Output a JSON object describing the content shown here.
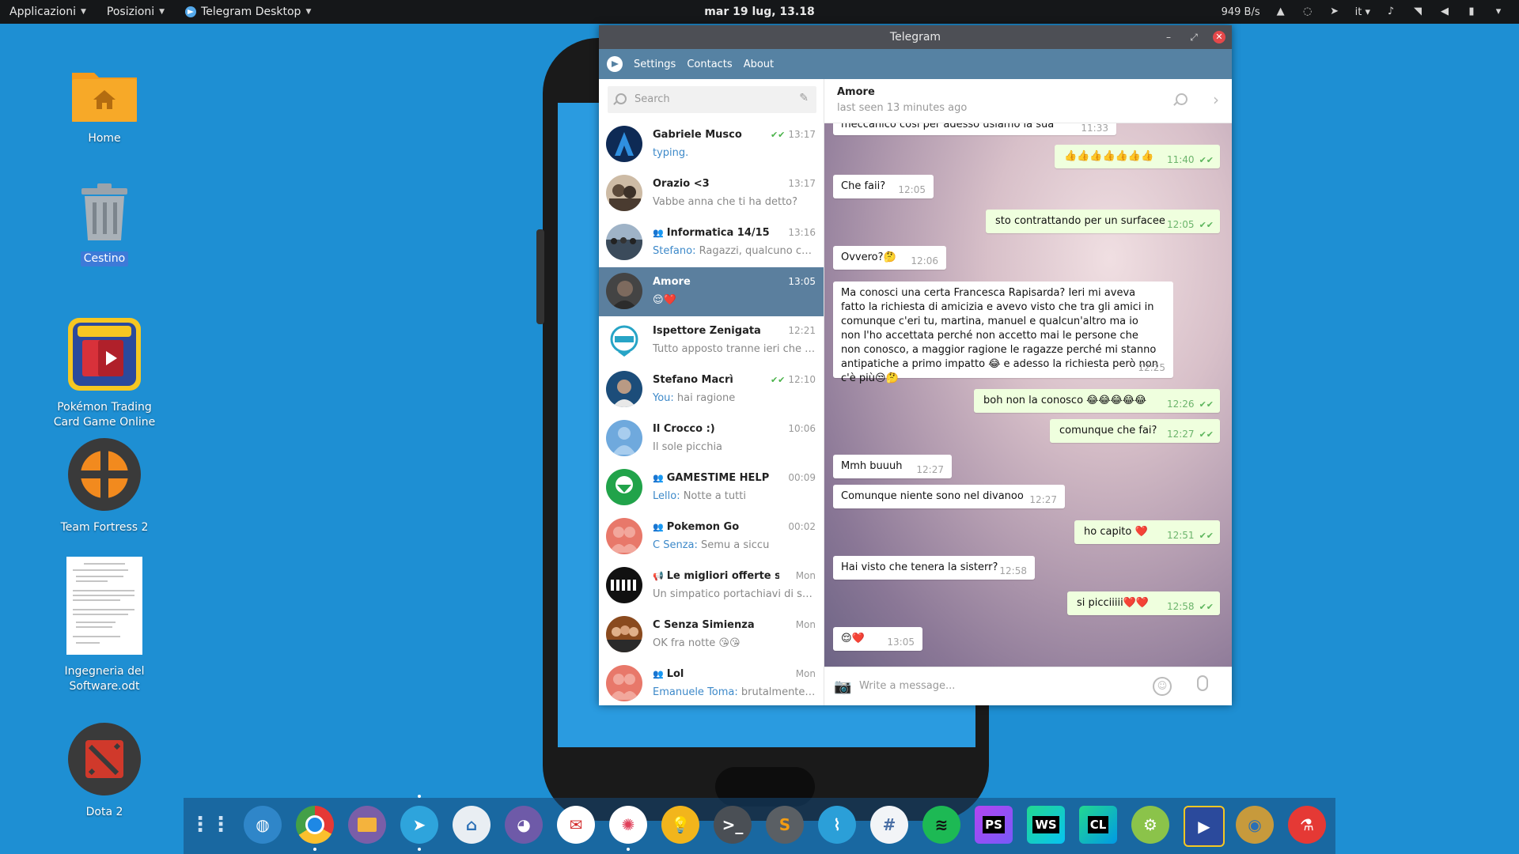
{
  "topbar": {
    "apps": "Applicazioni",
    "places": "Posizioni",
    "active_app": "Telegram Desktop",
    "clock": "mar 19 lug, 13.18",
    "net_speed": "949 B/s",
    "lang": "it"
  },
  "desktop": {
    "icons": [
      {
        "label": "Home"
      },
      {
        "label": "Cestino"
      },
      {
        "label": "Pokémon Trading Card Game Online"
      },
      {
        "label": "Team Fortress 2"
      },
      {
        "label": "Ingegneria del Software.odt"
      },
      {
        "label": "Dota 2"
      }
    ]
  },
  "window": {
    "title": "Telegram",
    "menu": [
      "Settings",
      "Contacts",
      "About"
    ]
  },
  "sidebar": {
    "search_placeholder": "Search",
    "chats": [
      {
        "name": "Gabriele Musco",
        "time": "13:17",
        "preview": "typing.",
        "read": true
      },
      {
        "name": "Orazio <3",
        "time": "13:17",
        "preview": "Vabbe anna che ti ha detto?"
      },
      {
        "name": "Informatica 14/15",
        "time": "13:16",
        "sender": "Stefano:",
        "preview": " Ragazzi, qualcuno che ...",
        "group": true
      },
      {
        "name": "Amore",
        "time": "13:05",
        "preview": "😌❤️",
        "active": true
      },
      {
        "name": "Ispettore Zenigata",
        "time": "12:21",
        "preview": "Tutto apposto tranne ieri che è s..."
      },
      {
        "name": "Stefano Macrì",
        "time": "12:10",
        "sender": "You:",
        "preview": " hai ragione",
        "read": true
      },
      {
        "name": "Il Crocco :)",
        "time": "10:06",
        "preview": "Il sole picchia"
      },
      {
        "name": "GAMESTIME HELP",
        "time": "00:09",
        "sender": "Lello:",
        "preview": " Notte a tutti",
        "group": true
      },
      {
        "name": "Pokemon Go",
        "time": "00:02",
        "sender": "C Senza:",
        "preview": " Semu a siccu",
        "group": true
      },
      {
        "name": "Le migliori offerte su ...",
        "time": "Mon",
        "preview": "Un simpatico portachiavi di star...",
        "channel": true
      },
      {
        "name": "C Senza Simienza",
        "time": "Mon",
        "preview": "OK fra notte 😘😘"
      },
      {
        "name": "Lol",
        "time": "Mon",
        "sender": "Emanuele Toma:",
        "preview": " brutalmente ar...",
        "group": true
      }
    ]
  },
  "conversation": {
    "name": "Amore",
    "status": "last seen 13 minutes ago",
    "compose_placeholder": "Write a message...",
    "messages": [
      {
        "out": false,
        "text": "meccanico così per adesso usiamo la sua",
        "time": "11:33"
      },
      {
        "out": true,
        "text": "👍👍👍👍👍👍👍",
        "time": "11:40"
      },
      {
        "out": false,
        "text": "Che faii?",
        "time": "12:05"
      },
      {
        "out": true,
        "text": "sto contrattando per un surfacee",
        "time": "12:05"
      },
      {
        "out": false,
        "text": "Ovvero?🤔",
        "time": "12:06"
      },
      {
        "out": false,
        "text": "Ma conosci una certa Francesca Rapisarda? Ieri mi aveva fatto la richiesta di amicizia e avevo visto che tra gli amici in comunque c'eri tu, martina, manuel e qualcun'altro ma io non l'ho accettata perché non accetto mai le persone che non conosco, a maggior ragione le ragazze perché mi stanno antipatiche a primo impatto 😂 e adesso la richiesta però non c'è più😒🤔",
        "time": "12:25"
      },
      {
        "out": true,
        "text": "boh non la conosco 😂😂😂😂😂",
        "time": "12:26"
      },
      {
        "out": true,
        "text": "comunque che fai?",
        "time": "12:27"
      },
      {
        "out": false,
        "text": "Mmh buuuh",
        "time": "12:27"
      },
      {
        "out": false,
        "text": "Comunque niente sono nel divanoo",
        "time": "12:27"
      },
      {
        "out": true,
        "text": "ho capito ❤️",
        "time": "12:51"
      },
      {
        "out": false,
        "text": "Hai visto che tenera la sisterr?",
        "time": "12:58"
      },
      {
        "out": true,
        "text": "si picciiiii❤️❤️",
        "time": "12:58"
      },
      {
        "out": false,
        "text": "😌❤️",
        "time": "13:05"
      }
    ]
  },
  "dock": {
    "apps": [
      "apps-grid",
      "browser",
      "chrome",
      "files",
      "telegram",
      "remote",
      "pidgin",
      "mail",
      "popcorn",
      "ideas",
      "terminal",
      "sublime",
      "monitor",
      "slack",
      "spotify",
      "phpstorm",
      "webstorm",
      "clion",
      "android-studio",
      "pokemon-tcg",
      "hearthstone",
      "git"
    ]
  }
}
